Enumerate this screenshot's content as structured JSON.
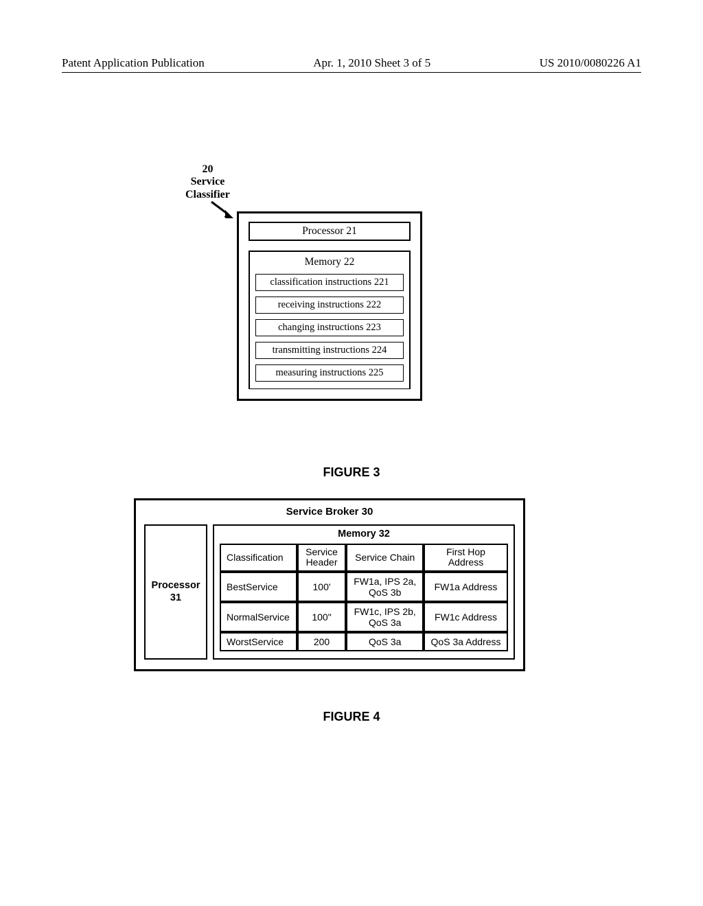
{
  "header": {
    "left": "Patent Application Publication",
    "center": "Apr. 1, 2010  Sheet 3 of 5",
    "right": "US 2010/0080226 A1"
  },
  "fig3": {
    "label_line1": "20",
    "label_line2": "Service",
    "label_line3": "Classifier",
    "processor": "Processor 21",
    "memory_title": "Memory 22",
    "instructions": [
      "classification instructions 221",
      "receiving instructions  222",
      "changing instructions 223",
      "transmitting instructions 224",
      "measuring instructions 225"
    ],
    "caption": "FIGURE 3"
  },
  "fig4": {
    "outer_title": "Service Broker 30",
    "processor": "Processor 31",
    "memory_title": "Memory 32",
    "columns": [
      "Classification",
      "Service Header",
      "Service Chain",
      "First Hop Address"
    ],
    "rows": [
      {
        "classification": "BestService",
        "header": "100'",
        "chain": "FW1a, IPS 2a, QoS 3b",
        "firsthop": "FW1a Address"
      },
      {
        "classification": "NormalService",
        "header": "100\"",
        "chain": "FW1c, IPS 2b, QoS 3a",
        "firsthop": "FW1c Address"
      },
      {
        "classification": "WorstService",
        "header": "200",
        "chain": "QoS 3a",
        "firsthop": "QoS 3a Address"
      }
    ],
    "caption": "FIGURE 4"
  }
}
